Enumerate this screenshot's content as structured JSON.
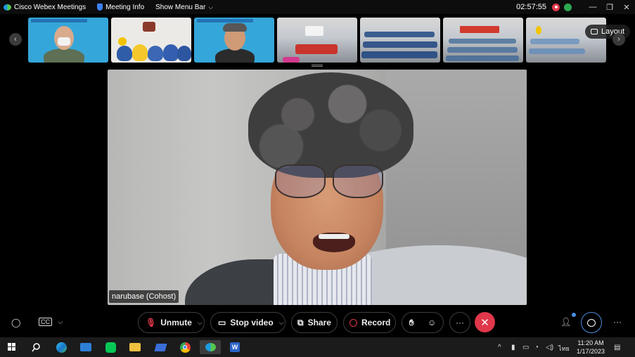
{
  "titlebar": {
    "app_name": "Cisco Webex Meetings",
    "meeting_info": "Meeting Info",
    "show_menu_bar": "Show Menu Bar",
    "clock": "02:57:55"
  },
  "layout_button": "Layout",
  "main_video": {
    "participant_label": "narubase (Cohost)"
  },
  "controls": {
    "unmute": "Unmute",
    "stop_video": "Stop video",
    "share": "Share",
    "record": "Record",
    "more": "···",
    "far_more": "···"
  },
  "taskbar": {
    "language": "ไทย",
    "time": "11:20 AM",
    "date": "1/17/2023"
  },
  "colors": {
    "end_call": "#e0384a",
    "recording": "#e0384a",
    "accent": "#4a90e2"
  }
}
